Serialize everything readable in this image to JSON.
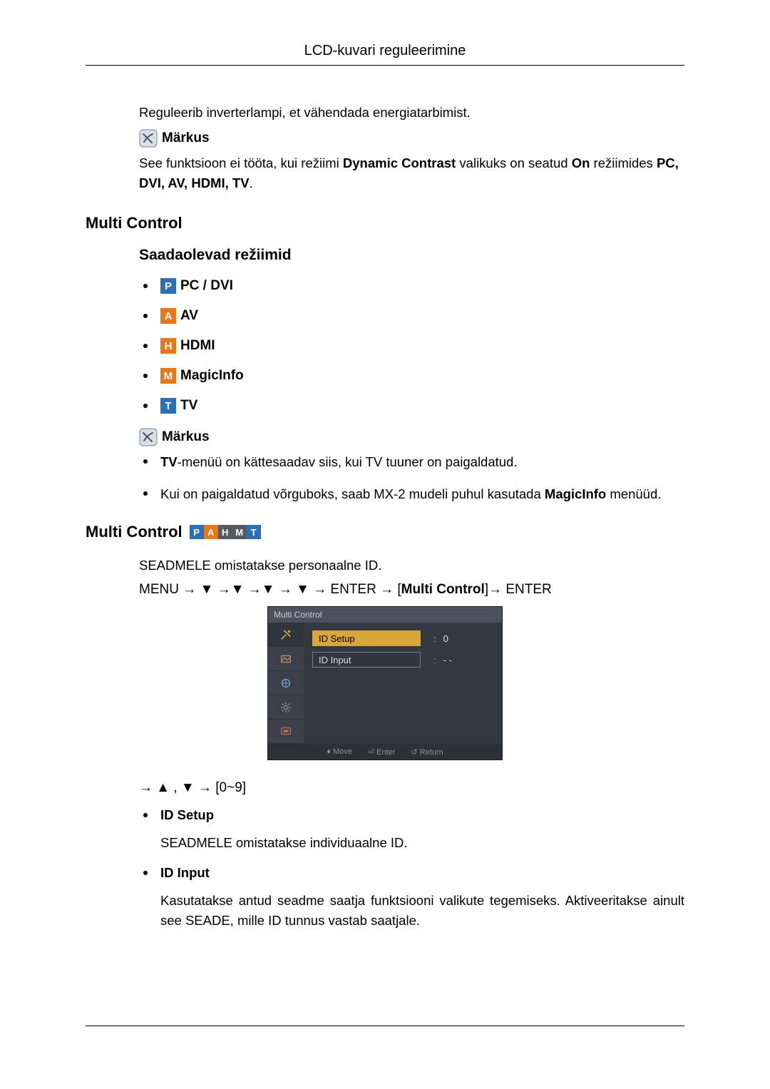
{
  "header": {
    "title": "LCD-kuvari reguleerimine"
  },
  "intro": {
    "text": "Reguleerib inverterlampi, et vähendada energiatarbimist.",
    "note_label": "Märkus",
    "note_text_pre": "See funktsioon ei tööta, kui režiimi ",
    "note_bold1": "Dynamic Contrast",
    "note_text_mid": " valikuks on seatud ",
    "note_bold2": "On",
    "note_text_mid2": " režiimides ",
    "note_bold3": "PC, DVI, AV, HDMI, TV",
    "note_text_end": "."
  },
  "multi_control": {
    "title": "Multi Control",
    "subtitle": "Saadaolevad režiimid",
    "modes": [
      {
        "letter": "P",
        "cls": "p",
        "label": "PC / DVI"
      },
      {
        "letter": "A",
        "cls": "a",
        "label": "AV"
      },
      {
        "letter": "H",
        "cls": "h",
        "label": "HDMI"
      },
      {
        "letter": "M",
        "cls": "m",
        "label": "MagicInfo"
      },
      {
        "letter": "T",
        "cls": "t",
        "label": "TV"
      }
    ],
    "note_label": "Märkus",
    "notes": [
      {
        "pre": "",
        "bold": "TV",
        "post": "-menüü on kättesaadav siis, kui TV tuuner on paigaldatud."
      },
      {
        "pre": "Kui on paigaldatud võrguboks, saab MX-2 mudeli puhul kasutada ",
        "bold": "MagicInfo",
        "post": " menüüd."
      }
    ]
  },
  "mc_section": {
    "title": "Multi Control",
    "strip": [
      "P",
      "A",
      "H",
      "M",
      "T"
    ],
    "intro": "SEADMELE omistatakse personaalne ID.",
    "menu_path_pre": "MENU → ▼ →▼ →▼ → ▼ → ENTER → [",
    "menu_path_bold": "Multi Control",
    "menu_path_post": "]→ ENTER",
    "osd": {
      "top": "Multi Control",
      "rows": [
        {
          "label": "ID  Setup",
          "value": "0",
          "active": true
        },
        {
          "label": "ID  Input",
          "value": "- -",
          "active": false
        }
      ],
      "bottom": {
        "move": "Move",
        "enter": "Enter",
        "ret": "Return"
      }
    },
    "post_nav": "→ ▲ , ▼ → [0~9]",
    "items": [
      {
        "label": "ID Setup",
        "desc": "SEADMELE omistatakse individuaalne ID."
      },
      {
        "label": "ID Input",
        "desc": "Kasutatakse antud seadme saatja funktsiooni valikute tegemiseks. Aktiveeritakse ainult see SEADE, mille ID tunnus vastab saatjale."
      }
    ]
  }
}
